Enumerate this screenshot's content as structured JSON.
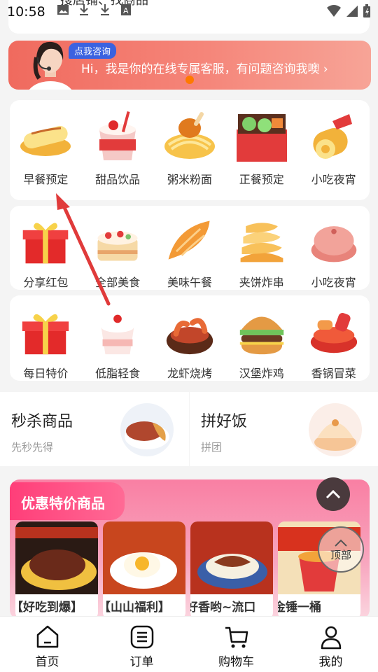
{
  "status_bar": {
    "time": "10:58"
  },
  "search": {
    "text": "搜店铺、找商品"
  },
  "service_banner": {
    "tag": "点我咨询",
    "text": "Hi，我是你的在线专属客服，有问题咨询我噢 ›"
  },
  "category_rows": [
    {
      "items": [
        {
          "label": "早餐预定",
          "icon": "hotdog-icon"
        },
        {
          "label": "甜品饮品",
          "icon": "drink-cup-icon"
        },
        {
          "label": "粥米粉面",
          "icon": "noodles-icon"
        },
        {
          "label": "正餐预定",
          "icon": "bento-box-icon"
        },
        {
          "label": "小吃夜宵",
          "icon": "roll-snack-icon"
        }
      ]
    },
    {
      "items": [
        {
          "label": "分享红包",
          "icon": "gift-box-icon"
        },
        {
          "label": "全部美食",
          "icon": "cake-icon"
        },
        {
          "label": "美味午餐",
          "icon": "croissant-icon"
        },
        {
          "label": "夹饼炸串",
          "icon": "pancake-stack-icon"
        },
        {
          "label": "小吃夜宵",
          "icon": "bun-icon"
        }
      ]
    },
    {
      "items": [
        {
          "label": "每日特价",
          "icon": "gift-box-icon"
        },
        {
          "label": "低脂轻食",
          "icon": "yogurt-cup-icon"
        },
        {
          "label": "龙虾烧烤",
          "icon": "crayfish-bowl-icon"
        },
        {
          "label": "汉堡炸鸡",
          "icon": "burger-icon"
        },
        {
          "label": "香锅冒菜",
          "icon": "hotpot-icon"
        }
      ]
    }
  ],
  "promos": [
    {
      "title": "秒杀商品",
      "subtitle": "先秒先得"
    },
    {
      "title": "拼好饭",
      "subtitle": "拼团"
    }
  ],
  "deals": {
    "title": "优惠特价商品",
    "items": [
      {
        "name": "【好吃到爆】"
      },
      {
        "name": "【山山福利】"
      },
      {
        "name": "好香哟~流口"
      },
      {
        "name": "金锤一桶"
      }
    ]
  },
  "back_to_top": {
    "label": "顶部"
  },
  "bottom_nav": [
    {
      "label": "首页",
      "icon": "home-icon"
    },
    {
      "label": "订单",
      "icon": "order-list-icon"
    },
    {
      "label": "购物车",
      "icon": "cart-icon"
    },
    {
      "label": "我的",
      "icon": "user-icon"
    }
  ],
  "colors": {
    "accent": "#ff3e79",
    "banner": "#f06a5e",
    "annotation_arrow": "#e03a3a"
  }
}
